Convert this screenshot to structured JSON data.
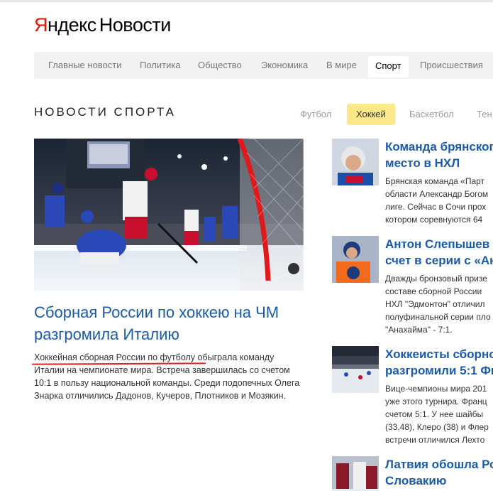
{
  "logo": {
    "brand_first": "Я",
    "brand_rest": "ндекс",
    "product": "Новости"
  },
  "nav": {
    "items": [
      "Главные новости",
      "Политика",
      "Общество",
      "Экономика",
      "В мире",
      "Спорт",
      "Происшествия"
    ],
    "active": "Спорт"
  },
  "section": {
    "title": "НОВОСТИ СПОРТА",
    "tabs": [
      "Футбол",
      "Хоккей",
      "Баскетбол",
      "Тен"
    ],
    "active_tab": "Хоккей"
  },
  "main": {
    "title": "Сборная России по хоккею на ЧМ разгромила Италию",
    "text_underlined": "Хоккейная сборная России по футболу",
    "text_rest": " обыграла команду Италии на чемпионате мира. Встреча завершилась со счетом 10:1 в пользу национальной команды. Среди подопечных Олега Знарка отличились Дадонов, Кучеров, Плотников и Мозякин."
  },
  "side": [
    {
      "title": [
        "Команда брянског",
        "место в НХЛ"
      ],
      "lines": [
        "Брянская команда «Парт",
        "области Александр Богом",
        "лиге. Сейчас в Сочи прох",
        "котором соревнуются 64"
      ]
    },
    {
      "title": [
        "Антон Слепышев п",
        "счет в серии с «Ан"
      ],
      "lines": [
        "Дважды бронзовый призе",
        "составе сборной России",
        "НХЛ \"Эдмонтон\" отличил",
        "полуфинальной серии пло",
        "\"Анахайма\" - 7:1."
      ]
    },
    {
      "title": [
        "Хоккеисты сборно",
        "разгромили 5:1 Фи"
      ],
      "lines": [
        "Вице-чемпионы мира 201",
        "уже этого турнира. Франц",
        "счетом 5:1. У нее шайбы",
        "(33,48), Клеро (38) и Флер",
        "встречи отличился Лехто"
      ]
    },
    {
      "title": [
        "Латвия обошла Ро",
        "Словакию"
      ],
      "lines": []
    }
  ]
}
